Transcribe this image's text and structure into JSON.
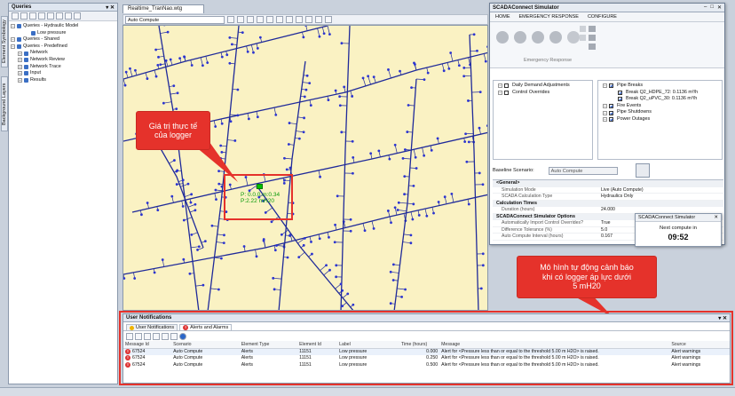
{
  "queries_panel": {
    "title": "Queries",
    "tree": [
      {
        "label": "Queries - Hydraulic Model",
        "indent": 0,
        "expanded": true
      },
      {
        "label": "Low pressure",
        "indent": 2,
        "expanded": null
      },
      {
        "label": "Queries - Shared",
        "indent": 0,
        "expanded": true
      },
      {
        "label": "Queries - Predefined",
        "indent": 0,
        "expanded": true
      },
      {
        "label": "Network",
        "indent": 1,
        "expanded": false
      },
      {
        "label": "Network Review",
        "indent": 1,
        "expanded": false
      },
      {
        "label": "Network Trace",
        "indent": 1,
        "expanded": false
      },
      {
        "label": "Input",
        "indent": 1,
        "expanded": false
      },
      {
        "label": "Results",
        "indent": 1,
        "expanded": false
      }
    ]
  },
  "side_tabs": [
    "Element Symbology",
    "Background Layers"
  ],
  "document_tab": "Realtime_TranNao.wtg",
  "map_toolbar": {
    "scenario_select": "Auto Compute"
  },
  "map": {
    "logger_label_lines": [
      "P: 0.0.0 m:0.34",
      "P:2.22 mH20"
    ]
  },
  "callouts": {
    "logger": "Giá trị thực tế\ncủa logger",
    "model": "Mô hình tự động cảnh báo\nkhi có logger áp lực dưới\n5 mH20"
  },
  "scada": {
    "title": "SCADAConnect Simulator",
    "menu": [
      "HOME",
      "EMERGENCY RESPONSE",
      "CONFIGURE"
    ],
    "ribbon_group": "Emergency Response",
    "left_tree": [
      {
        "label": "Daily Demand Adjustments",
        "checked": false
      },
      {
        "label": "Control Overrides",
        "checked": false
      }
    ],
    "right_tree": [
      {
        "label": "Pipe Breaks",
        "checked": true,
        "indent": 0
      },
      {
        "label": "Break Q2_HDPE_72: 0.1136 m³/h",
        "checked": true,
        "indent": 1
      },
      {
        "label": "Break Q2_uPVC_30: 0.1136 m³/h",
        "checked": true,
        "indent": 1
      },
      {
        "label": "Fire Events",
        "checked": true,
        "indent": 0
      },
      {
        "label": "Pipe Shutdowns",
        "checked": true,
        "indent": 0
      },
      {
        "label": "Power Outages",
        "checked": true,
        "indent": 0
      }
    ],
    "baseline_label": "Baseline Scenario:",
    "baseline_value": "Auto Compute",
    "properties": [
      {
        "category": "<General>",
        "rows": [
          {
            "k": "Simulation Mode",
            "v": "Live (Auto Compute)"
          },
          {
            "k": "SCADA Calculation Type",
            "v": "Hydraulics Only"
          }
        ]
      },
      {
        "category": "Calculation Times",
        "rows": [
          {
            "k": "Duration (hours)",
            "v": "24.000"
          }
        ]
      },
      {
        "category": "SCADAConnect Simulator Options",
        "rows": [
          {
            "k": "Automatically Import Control Overrides?",
            "v": "True"
          },
          {
            "k": "Difference Tolerance (%)",
            "v": "5.0"
          },
          {
            "k": "Auto Compute Interval (hours)",
            "v": "0.167"
          }
        ]
      }
    ]
  },
  "next_compute": {
    "title": "SCADAConnect Simulator",
    "label": "Next compute in",
    "time": "09:52"
  },
  "notifications": {
    "title": "User Notifications",
    "tabs": [
      "User Notifications",
      "Alerts and Alarms"
    ],
    "columns": [
      "Message Id",
      "Scenario",
      "Element Type",
      "Element Id",
      "Label",
      "Time (hours)",
      "Message",
      "Source"
    ],
    "rows": [
      [
        "67524",
        "Auto Compute",
        "Alerts",
        "11151",
        "Low pressure",
        "0.000",
        "Alert for <Pressure less than or equal to the threshold 5.00 m H2O> is raised.",
        "Alert warnings"
      ],
      [
        "67524",
        "Auto Compute",
        "Alerts",
        "11151",
        "Low pressure",
        "0.250",
        "Alert for <Pressure less than or equal to the threshold 5.00 m H2O> is raised.",
        "Alert warnings"
      ],
      [
        "67524",
        "Auto Compute",
        "Alerts",
        "11151",
        "Low pressure",
        "0.500",
        "Alert for <Pressure less than or equal to the threshold 5.00 m H2O> is raised.",
        "Alert warnings"
      ]
    ]
  },
  "colors": {
    "accent_red": "#e5322b",
    "pipe_blue": "#1f2a9a",
    "node_blue": "#2b34d0",
    "map_bg": "#faf2c3",
    "logger_green": "#00c000"
  }
}
